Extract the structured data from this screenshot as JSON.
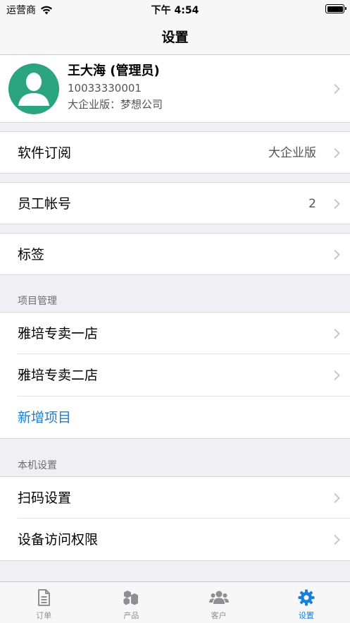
{
  "status_bar": {
    "carrier": "运营商",
    "time": "下午 4:54"
  },
  "nav": {
    "title": "设置"
  },
  "profile": {
    "name": "王大海 (管理员)",
    "phone": "10033330001",
    "plan": "大企业版：梦想公司"
  },
  "rows": {
    "subscription": {
      "label": "软件订阅",
      "value": "大企业版"
    },
    "staff": {
      "label": "员工帐号",
      "value": "2"
    },
    "tags": {
      "label": "标签"
    }
  },
  "projects": {
    "header": "项目管理",
    "items": [
      {
        "label": "雅培专卖一店"
      },
      {
        "label": "雅培专卖二店"
      }
    ],
    "add_label": "新增项目"
  },
  "device": {
    "header": "本机设置",
    "items": [
      {
        "label": "扫码设置"
      },
      {
        "label": "设备访问权限"
      }
    ]
  },
  "tabs": [
    {
      "label": "订单",
      "icon": "document-icon"
    },
    {
      "label": "产品",
      "icon": "boxes-icon"
    },
    {
      "label": "客户",
      "icon": "people-icon"
    },
    {
      "label": "设置",
      "icon": "gear-icon",
      "active": true
    }
  ],
  "colors": {
    "accent": "#1a7fd6",
    "avatar_bg": "#2aa57f",
    "group_bg": "#efeff4"
  }
}
